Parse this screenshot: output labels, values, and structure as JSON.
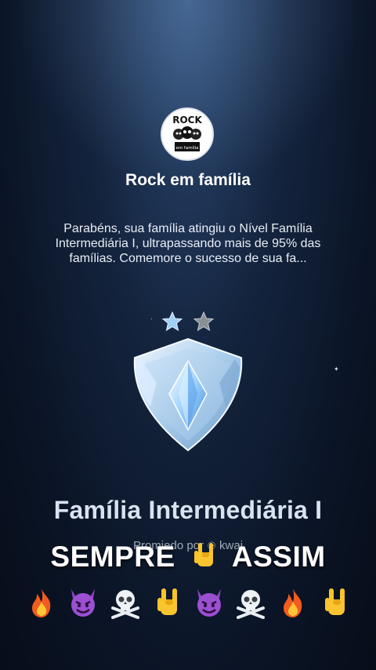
{
  "family": {
    "avatar_text_top": "ROCK",
    "avatar_text_bottom": "em família",
    "name": "Rock em família"
  },
  "message": "Parabéns, sua família atingiu o Nível Família Intermediária I, ultrapassando mais de 95% das famílias. Comemore o sucesso de sua fa...",
  "stars": {
    "filled": 1,
    "total": 2
  },
  "level": {
    "title": "Família Intermediária I",
    "promo_text": "Promiedo por",
    "promo_brand": "kwai"
  },
  "caption": {
    "before": "SEMPRE",
    "emoji": "rock-hand",
    "after": "ASSIM"
  },
  "emoji_row": [
    "fire",
    "devil",
    "skull-crossbones",
    "rock-hand",
    "devil",
    "skull-crossbones",
    "fire",
    "rock-hand"
  ],
  "colors": {
    "background": "#0b1527",
    "accent_blue": "#8fc3f0",
    "text": "#ffffff"
  }
}
